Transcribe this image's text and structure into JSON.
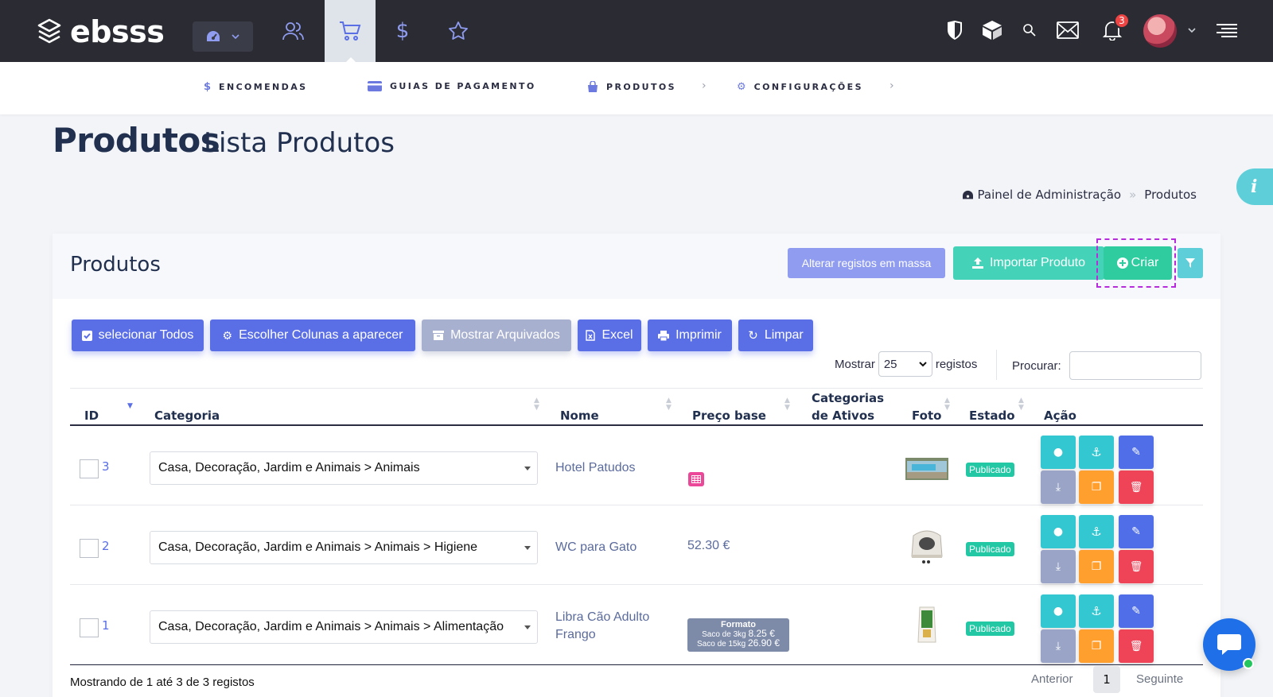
{
  "app": {
    "brand": "ebsss",
    "notifications_count": "3",
    "icons": [
      "layers-logo-icon",
      "dashboard-icon",
      "users-icon",
      "cart-icon",
      "dollar-icon",
      "star-icon",
      "shield-icon",
      "box-icon",
      "search-icon",
      "mail-icon",
      "bell-icon",
      "menu-icon"
    ],
    "colors": {
      "topbar": "#2b2c33",
      "primary": "#5a6ee6",
      "success": "#2ecc9f",
      "info": "#5ecfd9",
      "danger": "#ef4458",
      "warning": "#ff9f2e",
      "highlight": "#b62bdc"
    }
  },
  "subnav": {
    "items": [
      {
        "label": "ENCOMENDAS",
        "icon": "dollar-icon"
      },
      {
        "label": "GUIAS DE PAGAMENTO",
        "icon": "credit-card-icon"
      },
      {
        "label": "PRODUTOS",
        "icon": "shopping-bag-icon"
      },
      {
        "label": "CONFIGURAÇÕES",
        "icon": "cogs-icon"
      }
    ]
  },
  "page": {
    "title": "Produtos",
    "subtitle": "Lista Produtos",
    "breadcrumb": [
      "Painel de Administração",
      "Produtos"
    ]
  },
  "card": {
    "title": "Produtos",
    "buttons": {
      "mass_edit": "Alterar registos em massa",
      "import": "Importar Produto",
      "create": "Criar"
    },
    "toolbar": [
      "selecionar Todos",
      "Escolher Colunas a aparecer",
      "Mostrar Arquivados",
      "Excel",
      "Imprimir",
      "Limpar"
    ],
    "length": {
      "prefix": "Mostrar",
      "value": "25",
      "suffix": "registos"
    },
    "search": {
      "label": "Procurar:",
      "value": ""
    },
    "columns": [
      "ID",
      "Categoria",
      "Nome",
      "Preço base",
      "Categorias de Ativos",
      "Foto",
      "Estado",
      "Ação"
    ],
    "rows": [
      {
        "id": "3",
        "category": "Casa, Decoração, Jardim e Animais > Animais",
        "name": "Hotel Patudos",
        "price": "",
        "status": "Publicado"
      },
      {
        "id": "2",
        "category": "Casa, Decoração, Jardim e Animais > Animais > Higiene",
        "name": "WC para Gato",
        "price": "52.30 €",
        "status": "Publicado"
      },
      {
        "id": "1",
        "category": "Casa, Decoração, Jardim e Animais > Animais > Alimentação",
        "name": "Libra Cão Adulto Frango",
        "price": "",
        "status": "Publicado",
        "formats": {
          "title": "Formato",
          "lines": [
            {
              "label": "Saco de 3kg",
              "price": "8.25 €"
            },
            {
              "label": "Saco de 15kg",
              "price": "26.90 €"
            }
          ]
        }
      }
    ],
    "footer": {
      "info": "Mostrando de 1 até 3 de 3 registos",
      "prev": "Anterior",
      "page": "1",
      "next": "Seguinte"
    }
  }
}
